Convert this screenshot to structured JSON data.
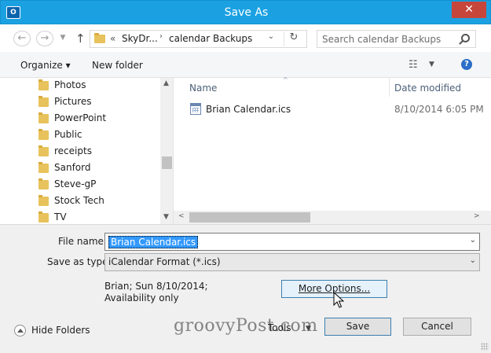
{
  "window": {
    "title": "Save As",
    "app_icon_text": "O",
    "close_glyph": "✕",
    "accent": "#1ba1e2"
  },
  "address": {
    "back_glyph": "←",
    "forward_glyph": "→",
    "up_glyph": "↑",
    "chevron": "«",
    "segment1": "SkyDr...",
    "separator": "›",
    "segment2": "calendar Backups",
    "dropdown_glyph": "⌄",
    "refresh_glyph": "↻"
  },
  "search": {
    "placeholder": "Search calendar Backups"
  },
  "toolbar": {
    "organize_label": "Organize ▾",
    "new_folder_label": "New folder",
    "view_glyph": "☷",
    "view_drop_glyph": "▼",
    "help_glyph": "?"
  },
  "nav": {
    "items": [
      {
        "label": "Photos"
      },
      {
        "label": "Pictures"
      },
      {
        "label": "PowerPoint"
      },
      {
        "label": "Public"
      },
      {
        "label": "receipts"
      },
      {
        "label": "Sanford"
      },
      {
        "label": "Steve-gP"
      },
      {
        "label": "Stock Tech"
      },
      {
        "label": "TV"
      }
    ],
    "scroll_up": "▲",
    "scroll_down": "▼"
  },
  "filelist": {
    "col_name": "Name",
    "col_date": "Date modified",
    "sort_glyph": "^",
    "files": [
      {
        "name": "Brian Calendar.ics",
        "date": "8/10/2014 6:05 PM"
      }
    ],
    "scroll_left": "<",
    "scroll_right": ">"
  },
  "form": {
    "file_name_label": "File name:",
    "file_name_value": "Brian Calendar.ics",
    "save_type_label": "Save as type:",
    "save_type_value": "iCalendar Format (*.ics)",
    "dropdown_glyph": "⌄",
    "meta_line1": "Brian; Sun 8/10/2014;",
    "meta_line2": "Availability only",
    "more_options": "More Options...",
    "hide_folders": "Hide Folders",
    "tools": "Tools",
    "tools_arrow": "▼",
    "save": "Save",
    "cancel": "Cancel"
  },
  "watermark": "groovyPost.com"
}
